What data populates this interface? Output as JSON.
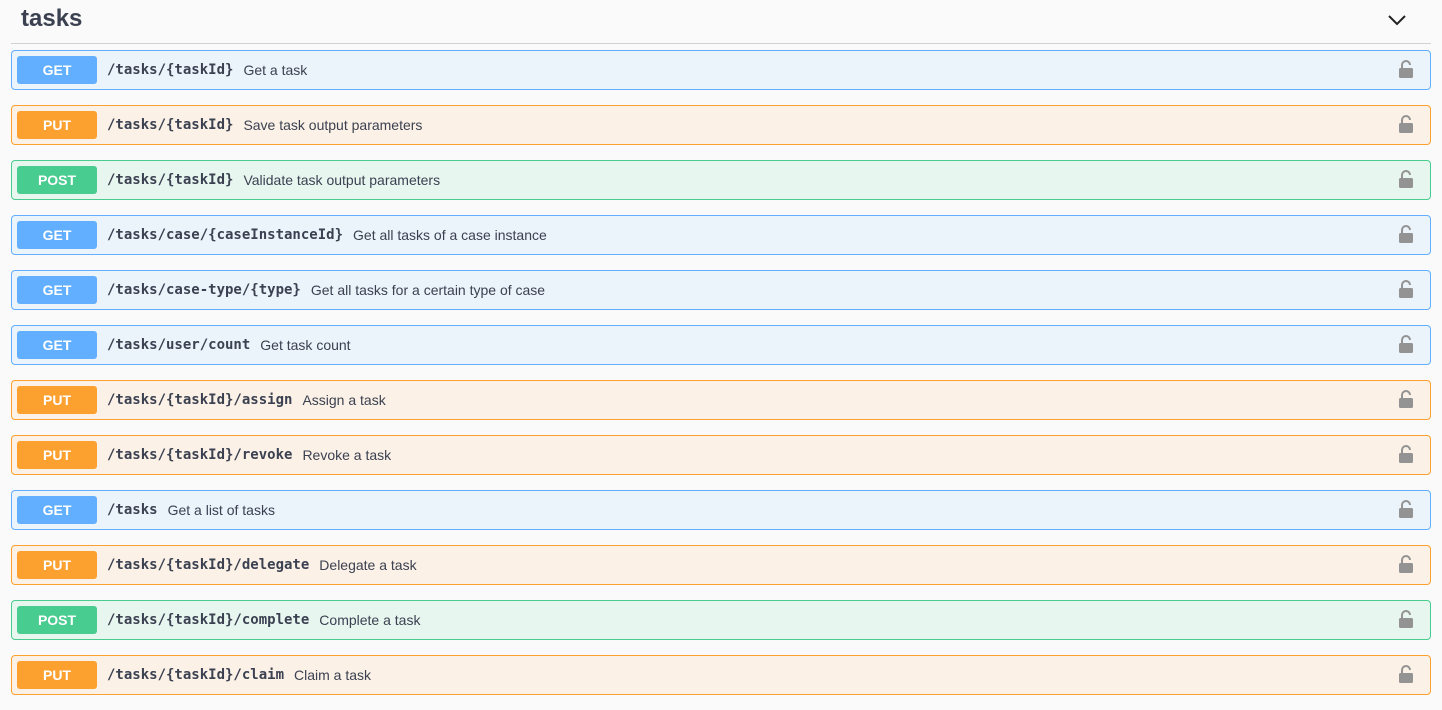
{
  "tag": {
    "title": "tasks",
    "collapse_icon": "chevron-down-icon"
  },
  "colors": {
    "GET": "#61affe",
    "PUT": "#fca130",
    "POST": "#49cc90"
  },
  "operations": [
    {
      "method": "GET",
      "path": "/tasks/{taskId}",
      "summary": "Get a task"
    },
    {
      "method": "PUT",
      "path": "/tasks/{taskId}",
      "summary": "Save task output parameters"
    },
    {
      "method": "POST",
      "path": "/tasks/{taskId}",
      "summary": "Validate task output parameters"
    },
    {
      "method": "GET",
      "path": "/tasks/case/{caseInstanceId}",
      "summary": "Get all tasks of a case instance"
    },
    {
      "method": "GET",
      "path": "/tasks/case-type/{type}",
      "summary": "Get all tasks for a certain type of case"
    },
    {
      "method": "GET",
      "path": "/tasks/user/count",
      "summary": "Get task count"
    },
    {
      "method": "PUT",
      "path": "/tasks/{taskId}/assign",
      "summary": "Assign a task"
    },
    {
      "method": "PUT",
      "path": "/tasks/{taskId}/revoke",
      "summary": "Revoke a task"
    },
    {
      "method": "GET",
      "path": "/tasks",
      "summary": "Get a list of tasks"
    },
    {
      "method": "PUT",
      "path": "/tasks/{taskId}/delegate",
      "summary": "Delegate a task"
    },
    {
      "method": "POST",
      "path": "/tasks/{taskId}/complete",
      "summary": "Complete a task"
    },
    {
      "method": "PUT",
      "path": "/tasks/{taskId}/claim",
      "summary": "Claim a task"
    }
  ],
  "lock_icon": "unlocked-padlock-icon"
}
